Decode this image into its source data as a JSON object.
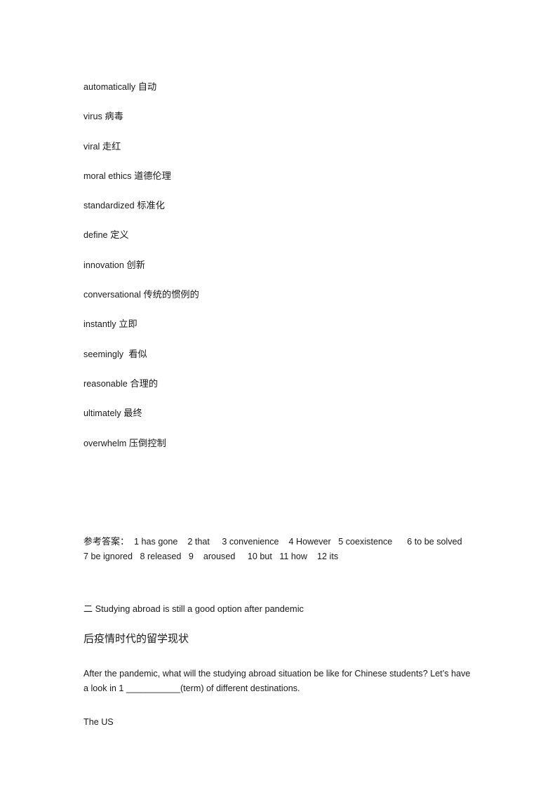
{
  "document": {
    "vocabulary": [
      {
        "term": "automatically",
        "gloss": "自动"
      },
      {
        "term": "virus",
        "gloss": "病毒"
      },
      {
        "term": "viral",
        "gloss": "走红"
      },
      {
        "term": "moral ethics",
        "gloss": "道德伦理"
      },
      {
        "term": "standardized",
        "gloss": "标准化"
      },
      {
        "term": "define",
        "gloss": "定义"
      },
      {
        "term": "innovation",
        "gloss": "创新"
      },
      {
        "term": "conversational",
        "gloss": "传统的惯例的"
      },
      {
        "term": "instantly",
        "gloss": "立即"
      },
      {
        "term": "seemingly ",
        "gloss": "看似"
      },
      {
        "term": "reasonable",
        "gloss": "合理的"
      },
      {
        "term": "ultimately",
        "gloss": "最终"
      },
      {
        "term": "overwhelm",
        "gloss": "压倒控制"
      }
    ],
    "answer_key": {
      "label": "参考答案：",
      "line1": "  1 has gone    2 that     3 convenience    4 However   5 coexistence      6 to be solved",
      "line2": "7 be ignored   8 released   9    aroused     10 but   11 how    12 its"
    },
    "section": {
      "number": "二",
      "title": "Studying abroad is still a good option after pandemic",
      "subtitle": "后疫情时代的留学现状",
      "paragraph": "After the pandemic, what will the studying abroad situation be like for Chinese students? Let’s have a look in 1 ___________(term) of different destinations.",
      "tail_line": "The US"
    }
  }
}
